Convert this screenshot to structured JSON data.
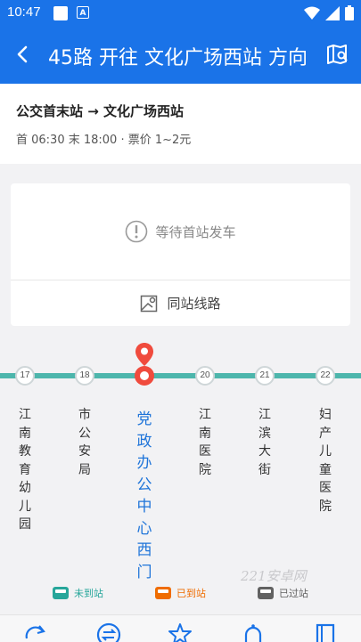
{
  "status": {
    "time": "10:47",
    "badge": "A"
  },
  "header": {
    "title": "45路 开往 文化广场西站 方向"
  },
  "info": {
    "route": "公交首末站 → 文化广场西站",
    "schedule": "首 06:30 末 18:00 · 票价 1~2元"
  },
  "card": {
    "waiting_text": "等待首站发车",
    "same_station_label": "同站线路"
  },
  "stops": [
    {
      "num": "17",
      "name": "江南教育幼儿园"
    },
    {
      "num": "18",
      "name": "市公安局"
    },
    {
      "num": "",
      "name": "党政办公中心西门"
    },
    {
      "num": "20",
      "name": "江南医院"
    },
    {
      "num": "21",
      "name": "江滨大街"
    },
    {
      "num": "22",
      "name": "妇产儿童医院"
    }
  ],
  "legend": {
    "not_arrived": "未到站",
    "arrived": "已到站",
    "passed": "已过站"
  },
  "watermark": "221安卓网",
  "colors": {
    "primary": "#1a73e8",
    "track": "#4db6ac",
    "current": "#f04b3d",
    "not_arrived": "#26a69a",
    "arrived": "#ef6c00",
    "passed": "#616161"
  }
}
